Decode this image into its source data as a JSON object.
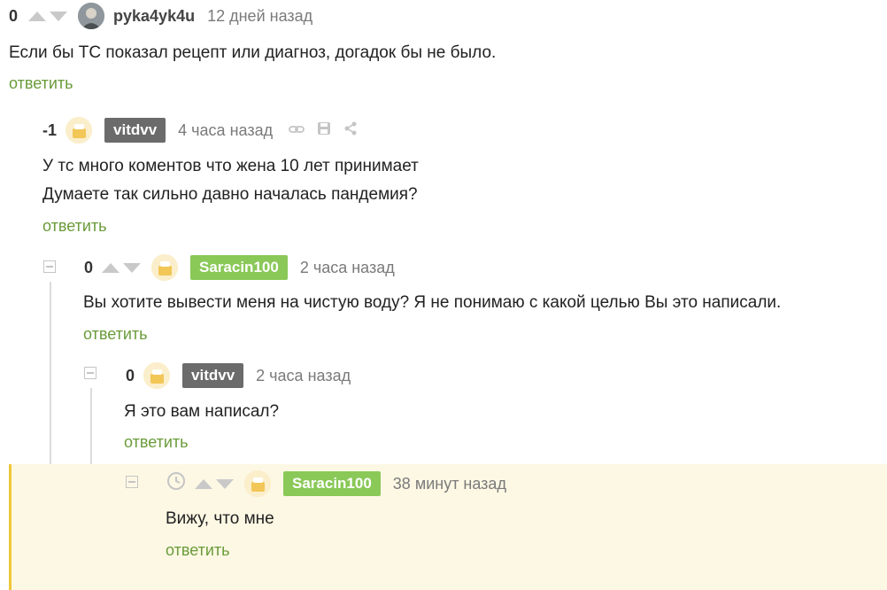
{
  "comments": [
    {
      "rating": "0",
      "username": "pyka4yk4u",
      "time": "12 дней назад",
      "lines": [
        "Если бы ТС показал рецепт или диагноз, догадок бы не было."
      ],
      "reply": "ответить"
    },
    {
      "rating": "-1",
      "username": "vitdvv",
      "time": "4 часа назад",
      "lines": [
        "У тс много коментов что жена 10 лет принимает",
        "Думаете так сильно давно началась пандемия?"
      ],
      "reply": "ответить"
    },
    {
      "rating": "0",
      "username": "Saracin100",
      "time": "2 часа назад",
      "lines": [
        "Вы хотите вывести меня на чистую воду? Я не понимаю с какой целью Вы это написали."
      ],
      "reply": "ответить"
    },
    {
      "rating": "0",
      "username": "vitdvv",
      "time": "2 часа назад",
      "lines": [
        "Я это вам написал?"
      ],
      "reply": "ответить"
    },
    {
      "rating": "",
      "username": "Saracin100",
      "time": "38 минут назад",
      "lines": [
        "Вижу, что мне"
      ],
      "reply": "ответить"
    }
  ],
  "icons": {
    "link": "link-icon",
    "save": "save-icon",
    "share": "share-icon",
    "clock": "clock-icon"
  },
  "colors": {
    "badge_gray": "#6b6b6b",
    "badge_green": "#8ac858",
    "reply_link": "#6a9b3a",
    "highlight_bg": "#fdf8e4",
    "highlight_border": "#f0c63a"
  }
}
